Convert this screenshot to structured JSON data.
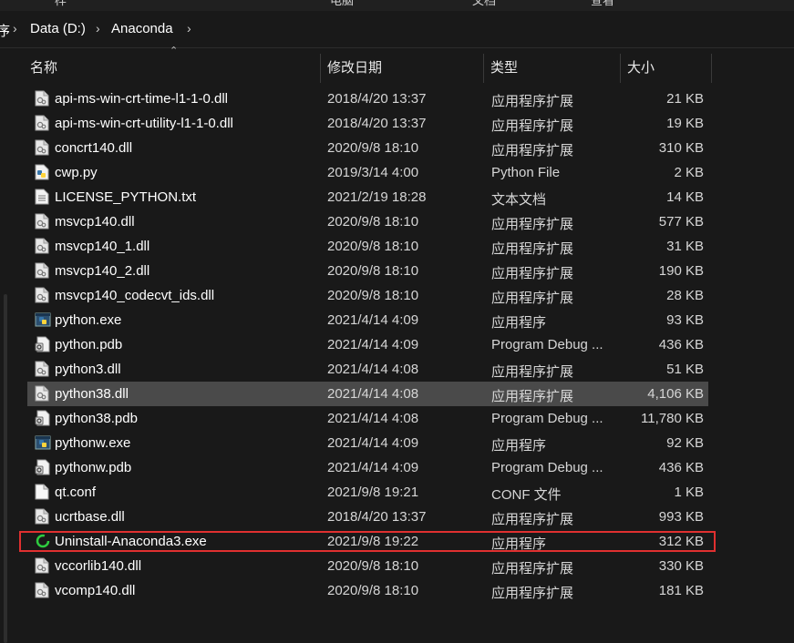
{
  "top_strip_fragments": [
    "样",
    "电脑",
    "文档",
    "查看"
  ],
  "breadcrumb": {
    "lead_fragment": "序",
    "items": [
      "Data (D:)",
      "Anaconda"
    ]
  },
  "columns": {
    "name": "名称",
    "date": "修改日期",
    "type": "类型",
    "size": "大小"
  },
  "files": [
    {
      "name": "api-ms-win-crt-time-l1-1-0.dll",
      "date": "2018/4/20 13:37",
      "type": "应用程序扩展",
      "size": "21 KB",
      "icon": "dll-file-icon",
      "selected": false,
      "highlighted": false
    },
    {
      "name": "api-ms-win-crt-utility-l1-1-0.dll",
      "date": "2018/4/20 13:37",
      "type": "应用程序扩展",
      "size": "19 KB",
      "icon": "dll-file-icon",
      "selected": false,
      "highlighted": false
    },
    {
      "name": "concrt140.dll",
      "date": "2020/9/8 18:10",
      "type": "应用程序扩展",
      "size": "310 KB",
      "icon": "dll-file-icon",
      "selected": false,
      "highlighted": false
    },
    {
      "name": "cwp.py",
      "date": "2019/3/14 4:00",
      "type": "Python File",
      "size": "2 KB",
      "icon": "python-file-icon",
      "selected": false,
      "highlighted": false
    },
    {
      "name": "LICENSE_PYTHON.txt",
      "date": "2021/2/19 18:28",
      "type": "文本文档",
      "size": "14 KB",
      "icon": "text-file-icon",
      "selected": false,
      "highlighted": false
    },
    {
      "name": "msvcp140.dll",
      "date": "2020/9/8 18:10",
      "type": "应用程序扩展",
      "size": "577 KB",
      "icon": "dll-file-icon",
      "selected": false,
      "highlighted": false
    },
    {
      "name": "msvcp140_1.dll",
      "date": "2020/9/8 18:10",
      "type": "应用程序扩展",
      "size": "31 KB",
      "icon": "dll-file-icon",
      "selected": false,
      "highlighted": false
    },
    {
      "name": "msvcp140_2.dll",
      "date": "2020/9/8 18:10",
      "type": "应用程序扩展",
      "size": "190 KB",
      "icon": "dll-file-icon",
      "selected": false,
      "highlighted": false
    },
    {
      "name": "msvcp140_codecvt_ids.dll",
      "date": "2020/9/8 18:10",
      "type": "应用程序扩展",
      "size": "28 KB",
      "icon": "dll-file-icon",
      "selected": false,
      "highlighted": false
    },
    {
      "name": "python.exe",
      "date": "2021/4/14 4:09",
      "type": "应用程序",
      "size": "93 KB",
      "icon": "python-exe-icon",
      "selected": false,
      "highlighted": false
    },
    {
      "name": "python.pdb",
      "date": "2021/4/14 4:09",
      "type": "Program Debug ...",
      "size": "436 KB",
      "icon": "pdb-file-icon",
      "selected": false,
      "highlighted": false
    },
    {
      "name": "python3.dll",
      "date": "2021/4/14 4:08",
      "type": "应用程序扩展",
      "size": "51 KB",
      "icon": "dll-file-icon",
      "selected": false,
      "highlighted": false
    },
    {
      "name": "python38.dll",
      "date": "2021/4/14 4:08",
      "type": "应用程序扩展",
      "size": "4,106 KB",
      "icon": "dll-file-icon",
      "selected": true,
      "highlighted": false
    },
    {
      "name": "python38.pdb",
      "date": "2021/4/14 4:08",
      "type": "Program Debug ...",
      "size": "11,780 KB",
      "icon": "pdb-file-icon",
      "selected": false,
      "highlighted": false
    },
    {
      "name": "pythonw.exe",
      "date": "2021/4/14 4:09",
      "type": "应用程序",
      "size": "92 KB",
      "icon": "python-exe-icon",
      "selected": false,
      "highlighted": false
    },
    {
      "name": "pythonw.pdb",
      "date": "2021/4/14 4:09",
      "type": "Program Debug ...",
      "size": "436 KB",
      "icon": "pdb-file-icon",
      "selected": false,
      "highlighted": false
    },
    {
      "name": "qt.conf",
      "date": "2021/9/8 19:21",
      "type": "CONF 文件",
      "size": "1 KB",
      "icon": "blank-file-icon",
      "selected": false,
      "highlighted": false
    },
    {
      "name": "ucrtbase.dll",
      "date": "2018/4/20 13:37",
      "type": "应用程序扩展",
      "size": "993 KB",
      "icon": "dll-file-icon",
      "selected": false,
      "highlighted": false
    },
    {
      "name": "Uninstall-Anaconda3.exe",
      "date": "2021/9/8 19:22",
      "type": "应用程序",
      "size": "312 KB",
      "icon": "uninstall-ring-icon",
      "selected": false,
      "highlighted": true
    },
    {
      "name": "vccorlib140.dll",
      "date": "2020/9/8 18:10",
      "type": "应用程序扩展",
      "size": "330 KB",
      "icon": "dll-file-icon",
      "selected": false,
      "highlighted": false
    },
    {
      "name": "vcomp140.dll",
      "date": "2020/9/8 18:10",
      "type": "应用程序扩展",
      "size": "181 KB",
      "icon": "dll-file-icon",
      "selected": false,
      "highlighted": false
    }
  ],
  "colors": {
    "background": "#191919",
    "selected_row": "#4a4a4a",
    "highlight_border": "#e03030",
    "python_blue": "#3776ab",
    "python_yellow": "#ffd43b",
    "uninstall_green": "#2ecc40"
  }
}
